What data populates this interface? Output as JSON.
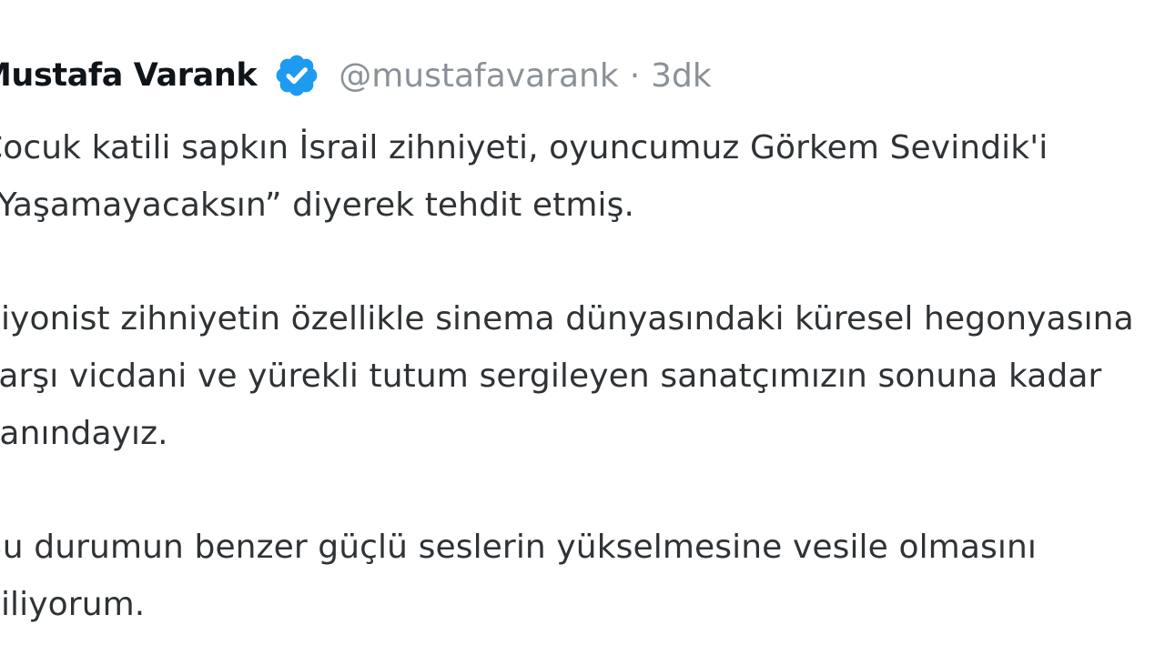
{
  "post": {
    "author": {
      "display_name": "Mustafa Varank",
      "handle": "@mustafavarank",
      "separator": "·",
      "time": "3dk",
      "verified_icon": "verified-badge-icon",
      "verified_color": "#1d9bf0"
    },
    "lines": {
      "l1": "Çocuk katili sapkın İsrail zihniyeti, oyuncumuz Görkem Sevindik'i",
      "l2": "“Yaşamayacaksın” diyerek tehdit etmiş.",
      "l3": "Siyonist zihniyetin özellikle sinema dünyasındaki küresel hegonyasına",
      "l4": "karşı vicdani ve yürekli tutum sergileyen sanatçımızın sonuna kadar",
      "l5": "yanındayız.",
      "l6": "Bu durumun benzer güçlü seslerin yükselmesine vesile olmasını",
      "l7": "diliyorum."
    }
  }
}
